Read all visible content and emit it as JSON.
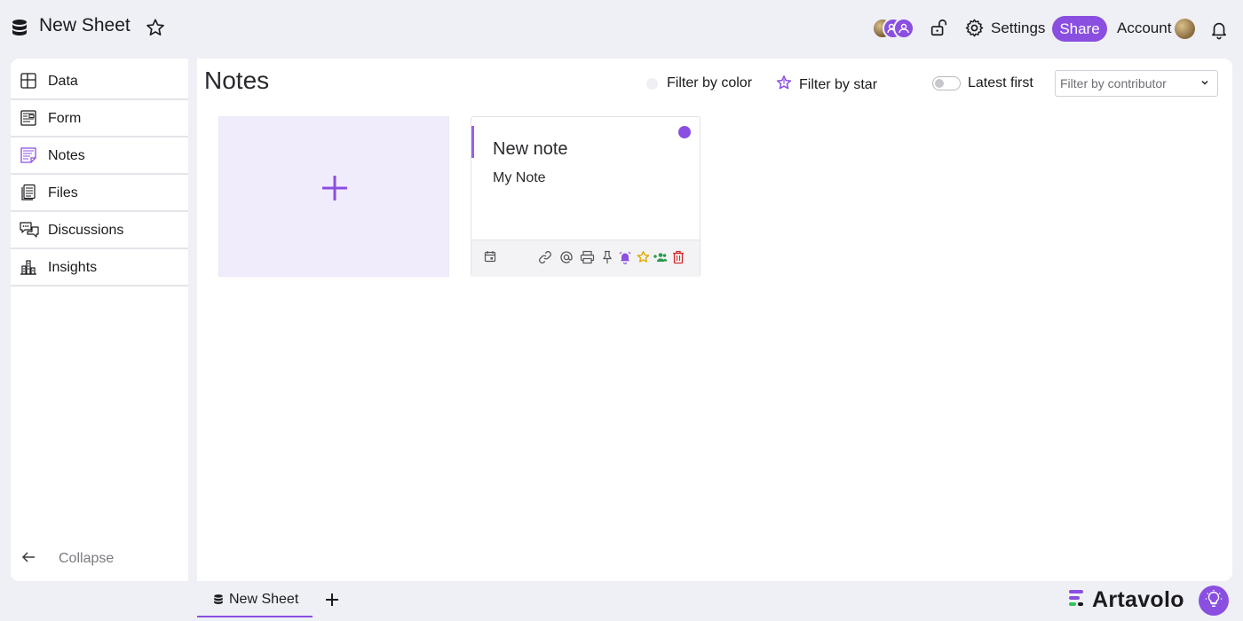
{
  "header": {
    "title": "New Sheet",
    "settings_label": "Settings",
    "share_label": "Share",
    "account_label": "Account"
  },
  "sidebar": {
    "items": [
      {
        "label": "Data",
        "icon": "table-grid-icon"
      },
      {
        "label": "Form",
        "icon": "form-icon"
      },
      {
        "label": "Notes",
        "icon": "notes-icon",
        "active": true
      },
      {
        "label": "Files",
        "icon": "files-icon"
      },
      {
        "label": "Discussions",
        "icon": "discussions-icon"
      },
      {
        "label": "Insights",
        "icon": "insights-icon"
      }
    ],
    "collapse_label": "Collapse"
  },
  "main": {
    "title": "Notes",
    "filter_color_label": "Filter by color",
    "filter_star_label": "Filter by star",
    "latest_first_label": "Latest first",
    "latest_first_on": false,
    "contributor_placeholder": "Filter by contributor",
    "notes": [
      {
        "title": "New note",
        "body": "My Note",
        "color": "#8a4fe0"
      }
    ]
  },
  "bottom": {
    "sheet_tab_label": "New Sheet",
    "brand_name": "Artavolo"
  },
  "colors": {
    "accent": "#8a4fe0",
    "background": "#eff0f5",
    "add_card": "#f1ecfc"
  }
}
